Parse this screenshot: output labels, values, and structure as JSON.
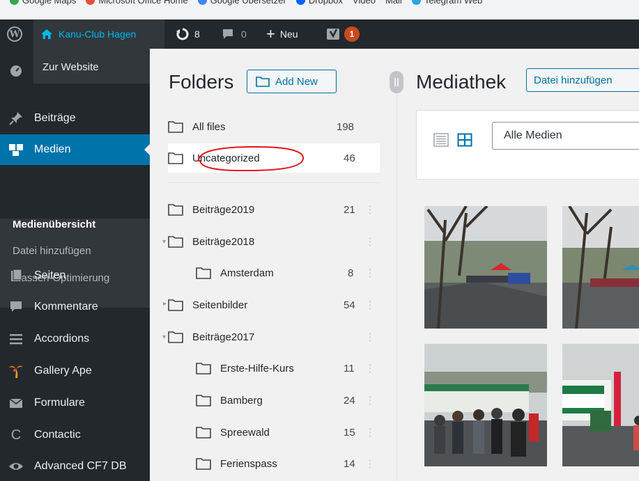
{
  "bookmarks": [
    {
      "label": "Google Maps",
      "color": "#34a853"
    },
    {
      "label": "Microsoft Office Home",
      "color": "#e74c3c"
    },
    {
      "label": "Google Übersetzer",
      "color": "#4285f4"
    },
    {
      "label": "Dropbox",
      "color": "#0061ff"
    },
    {
      "label": "Video",
      "color": ""
    },
    {
      "label": "Mail",
      "color": ""
    },
    {
      "label": "Telegram Web",
      "color": "#2ca5e0"
    }
  ],
  "adminbar": {
    "site_name": "Kanu-Club Hagen",
    "updates_count": "8",
    "comments_count": "0",
    "new_label": "Neu",
    "yoast_badge": "1"
  },
  "site_dropdown": {
    "visit_site": "Zur Website"
  },
  "menu": {
    "items": [
      {
        "label": "Beiträge",
        "icon": "pin-icon"
      },
      {
        "label": "Medien",
        "icon": "media-icon"
      },
      {
        "label": "Seiten",
        "icon": "pages-icon"
      },
      {
        "label": "Kommentare",
        "icon": "comments-icon"
      },
      {
        "label": "Accordions",
        "icon": "list-icon"
      },
      {
        "label": "Gallery Ape",
        "icon": "palm-icon"
      },
      {
        "label": "Formulare",
        "icon": "mail-icon"
      },
      {
        "label": "Contactic",
        "icon": "contactic-icon"
      },
      {
        "label": "Advanced CF7 DB",
        "icon": "eye-icon"
      }
    ],
    "submenu": [
      "Medienübersicht",
      "Datei hinzufügen",
      "Massen-Optimierung"
    ]
  },
  "folders": {
    "title": "Folders",
    "add_new": "Add New",
    "rows": [
      {
        "name": "All files",
        "count": "198"
      },
      {
        "name": "Uncategorized",
        "count": "46"
      },
      {
        "name": "Beiträge2019",
        "count": "21"
      },
      {
        "name": "Beiträge2018",
        "count": ""
      },
      {
        "name": "Amsterdam",
        "count": "8"
      },
      {
        "name": "Seitenbilder",
        "count": "54"
      },
      {
        "name": "Beiträge2017",
        "count": ""
      },
      {
        "name": "Erste-Hilfe-Kurs",
        "count": "11"
      },
      {
        "name": "Bamberg",
        "count": "24"
      },
      {
        "name": "Spreewald",
        "count": "15"
      },
      {
        "name": "Ferienspass",
        "count": "14"
      }
    ]
  },
  "media": {
    "title": "Mediathek",
    "add_file": "Datei hinzufügen",
    "filter_value": "Alle Medien"
  },
  "colors": {
    "adminbar": "#23282d",
    "menu_active": "#0073aa",
    "link_blue": "#0071a1",
    "annotation_red": "#e3151a"
  }
}
